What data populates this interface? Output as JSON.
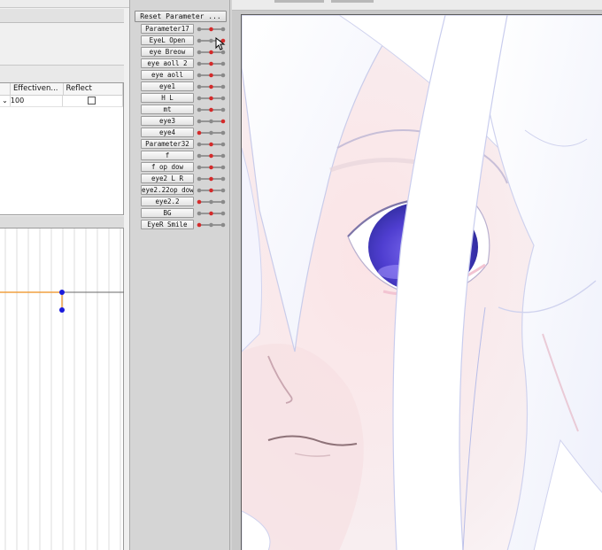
{
  "left_panel": {
    "table": {
      "columns": [
        "",
        "Effectiven...",
        "Reflect"
      ],
      "row": {
        "chevron": "⌄",
        "effectiveness": "100"
      }
    }
  },
  "parameters": {
    "reset_label": "Reset Parameter ...",
    "items": [
      {
        "label": "Parameter17",
        "value": 0.5
      },
      {
        "label": "EyeL Open",
        "value": 1.0
      },
      {
        "label": "eye Breow",
        "value": 0.5
      },
      {
        "label": "eye aoll 2",
        "value": 0.5
      },
      {
        "label": "eye aoll",
        "value": 0.5
      },
      {
        "label": "eye1",
        "value": 0.5
      },
      {
        "label": "H L",
        "value": 0.5
      },
      {
        "label": "mt",
        "value": 0.5
      },
      {
        "label": "eye3",
        "value": 1.0
      },
      {
        "label": "eye4",
        "value": 0.0
      },
      {
        "label": "Parameter32",
        "value": 0.5
      },
      {
        "label": "f",
        "value": 0.5
      },
      {
        "label": "f op dow",
        "value": 0.5
      },
      {
        "label": "eye2 L R",
        "value": 0.5
      },
      {
        "label": "eye2.22op dow",
        "value": 0.5
      },
      {
        "label": "eye2.2",
        "value": 0.0
      },
      {
        "label": "BG",
        "value": 0.5
      },
      {
        "label": "EyeR Smile",
        "value": 0.0
      }
    ]
  },
  "colors": {
    "keyframe_red": "#d42a2a",
    "keyframe_gray": "#8a8a8a",
    "curve_orange": "#f0a040",
    "curve_point_blue": "#1a1adc",
    "iris_blue": "#5848d8",
    "hair_white": "#fbfbff"
  },
  "icons": {
    "cursor": "mouse-pointer-icon",
    "chevron": "chevron-down-icon",
    "checkbox": "checkbox-icon"
  }
}
